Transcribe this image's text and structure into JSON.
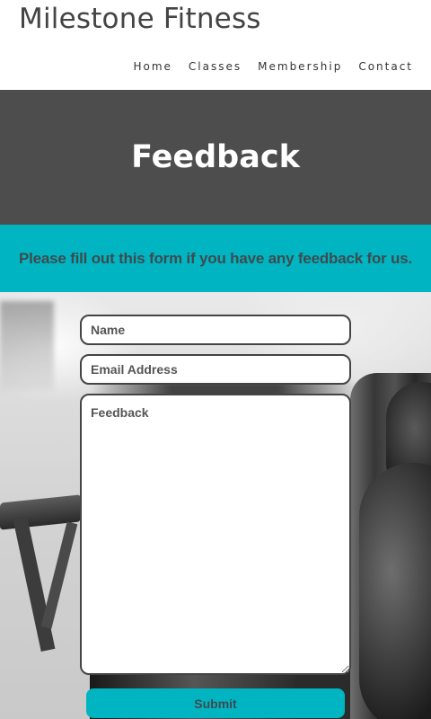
{
  "site": {
    "title": "Milestone Fitness"
  },
  "nav": {
    "items": [
      "Home",
      "Classes",
      "Membership",
      "Contact"
    ]
  },
  "hero": {
    "title": "Feedback"
  },
  "intro": {
    "text": "Please fill out this form if you have any feedback for us."
  },
  "form": {
    "name_placeholder": "Name",
    "email_placeholder": "Email Address",
    "feedback_placeholder": "Feedback",
    "submit_label": "Submit"
  },
  "colors": {
    "accent": "#00b5c1",
    "hero_bg": "#4d4d4d",
    "text_dark": "#3f4a4f",
    "title": "#444444"
  }
}
